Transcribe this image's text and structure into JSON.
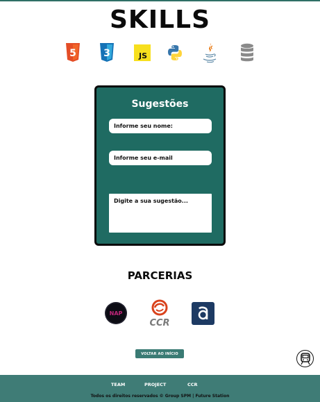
{
  "skills": {
    "title": "SKILLS",
    "icons": [
      "html5-icon",
      "css3-icon",
      "javascript-icon",
      "python-icon",
      "java-icon",
      "database-icon"
    ],
    "html_badge": "5",
    "css_badge": "3",
    "js_badge": "JS"
  },
  "form": {
    "title": "Sugestões",
    "name_placeholder": "Informe seu nome:",
    "email_placeholder": "Informe seu e-mail",
    "message_placeholder": "Digite a sua sugestão..."
  },
  "partners": {
    "title": "PARCERIAS",
    "ccr_label": "CCR",
    "nap_label": "NAP"
  },
  "back_button": "VOLTAR AO INÍCIO",
  "footer": {
    "links": [
      "TEAM",
      "PROJECT",
      "CCR"
    ],
    "copyright": "Todos os direitos reservados © Group SPM | Future Station"
  },
  "colors": {
    "accent": "#1f6b62",
    "footer": "#3f7c76",
    "button": "#3a7b74"
  }
}
